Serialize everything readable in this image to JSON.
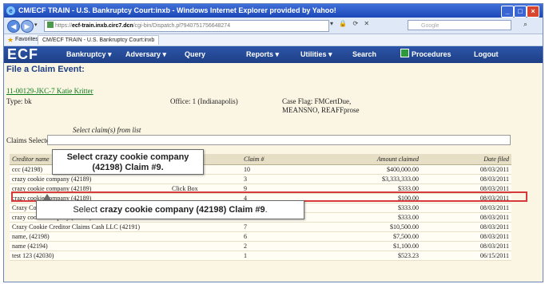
{
  "browser": {
    "title": "CM/ECF TRAIN - U.S. Bankruptcy Court:inxb - Windows Internet Explorer provided by Yahoo!",
    "url_prefix": "https://",
    "url_host": "ecf-train.inxb.circ7.dcn",
    "url_path": "/cgi-bin/Dispatch.pl?940751756648274",
    "search_placeholder": "Google",
    "favorites_label": "Favorites",
    "favorites_tab": "CM/ECF TRAIN - U.S. Bankruptcy Court:inxb"
  },
  "menu": {
    "logo": "ECF",
    "items": {
      "bankruptcy": "Bankruptcy ▾",
      "adversary": "Adversary ▾",
      "query": "Query",
      "reports": "Reports ▾",
      "utilities": "Utilities ▾",
      "search": "Search",
      "procedures": "Procedures",
      "logout": "Logout"
    }
  },
  "page": {
    "heading": "File a Claim Event:",
    "case_link": "11-00129-JKC-7 Katie Kritter",
    "type": "Type: bk",
    "office": "Office: 1 (Indianapolis)",
    "case_flag_line1": "Case Flag: FMCertDue,",
    "case_flag_line2": "MEANSNO, REAFFprose",
    "select_label": "Select claim(s) from list",
    "claims_selected_label": "Claims Selected:"
  },
  "table": {
    "headers": [
      "Creditor name",
      "",
      "Claim #",
      "Amount claimed",
      "Date filed"
    ],
    "rows": [
      {
        "name": "ccc   (42198)",
        "extra": "",
        "claim": "10",
        "amount": "$400,000.00",
        "date": "08/03/2011"
      },
      {
        "name": "crazy cookie company    (42189)",
        "extra": "",
        "claim": "3",
        "amount": "$3,333,333.00",
        "date": "08/03/2011"
      },
      {
        "name": "crazy cookie company    (42189)",
        "extra": "Click Box",
        "claim": "9",
        "amount": "$333.00",
        "date": "08/03/2011"
      },
      {
        "name": "crazy cookie company    (42189)",
        "extra": "",
        "claim": "4",
        "amount": "$100.00",
        "date": "08/03/2011"
      },
      {
        "name": "Crazy Cookie Company    (42197)",
        "extra": "",
        "claim": "2",
        "amount": "$333.00",
        "date": "08/03/2011"
      },
      {
        "name": "crazy cookie company    (42197)",
        "extra": "",
        "claim": "8",
        "amount": "$333.00",
        "date": "08/03/2011"
      },
      {
        "name": "Crazy Cookie Creditor Claims Cash LLC    (42191)",
        "extra": "",
        "claim": "7",
        "amount": "$10,500.00",
        "date": "08/03/2011"
      },
      {
        "name": "name,   (42198)",
        "extra": "",
        "claim": "6",
        "amount": "$7,500.00",
        "date": "08/03/2011"
      },
      {
        "name": "name    (42194)",
        "extra": "",
        "claim": "2",
        "amount": "$1,100.00",
        "date": "08/03/2011"
      },
      {
        "name": "test 123    (42030)",
        "extra": "",
        "claim": "1",
        "amount": "$523.23",
        "date": "06/15/2011"
      }
    ]
  },
  "callouts": {
    "top": "Select crazy cookie company (42198) Claim #9.",
    "bottom_prefix": "Select ",
    "bottom_bold": "crazy cookie company (42198) Claim #9",
    "bottom_suffix": "."
  }
}
